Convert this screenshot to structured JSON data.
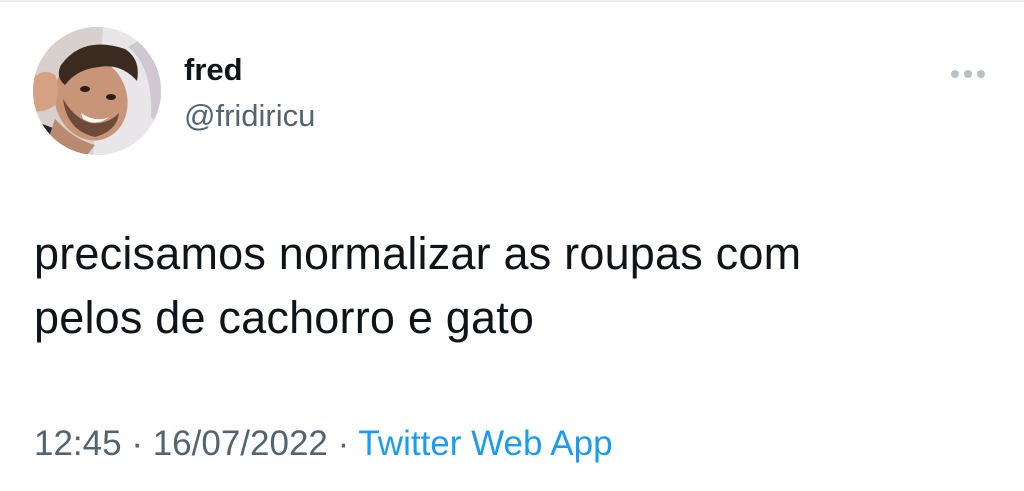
{
  "author": {
    "display_name": "fred",
    "handle": "@fridiricu"
  },
  "tweet": {
    "text_lines": [
      "precisamos normalizar as roupas com",
      "pelos de cachorro e gato"
    ],
    "time": "12:45",
    "separator_1": " · ",
    "date": "16/07/2022",
    "separator_2": " · ",
    "source": "Twitter Web App"
  },
  "icons": {
    "more": "more-options-icon",
    "avatar": "profile-photo"
  },
  "colors": {
    "text": "#0f1419",
    "secondary": "#536471",
    "link": "#1d9bf0"
  }
}
